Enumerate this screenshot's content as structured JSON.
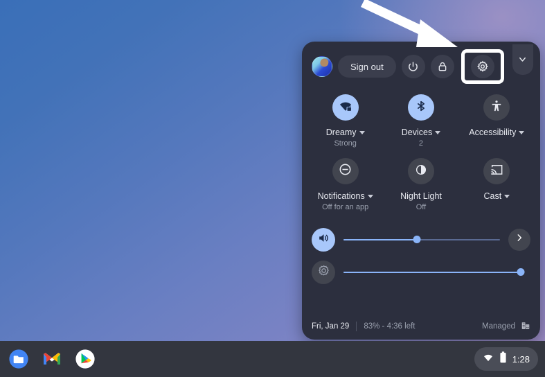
{
  "wallpaper": {
    "gradient_start": "#3a6fb8",
    "gradient_end": "#a08ac0"
  },
  "annotation": {
    "arrow_color": "#ffffff",
    "points_to": "settings-gear-button",
    "highlight_color": "#ffffff"
  },
  "quick_settings": {
    "panel_bg": "#2c2f3e",
    "top_row": {
      "avatar_name": "user-avatar",
      "sign_out_label": "Sign out",
      "power_label": "power-icon",
      "lock_label": "lock-icon",
      "settings_label": "gear-icon",
      "collapse_label": "chevron-down-icon"
    },
    "tiles": [
      {
        "id": "network",
        "icon": "wifi-locked-icon",
        "label": "Dreamy",
        "sublabel": "Strong",
        "state": "on",
        "has_caret": true
      },
      {
        "id": "bluetooth",
        "icon": "bluetooth-icon",
        "label": "Devices",
        "sublabel": "2",
        "state": "on",
        "has_caret": true
      },
      {
        "id": "accessibility",
        "icon": "accessibility-icon",
        "label": "Accessibility",
        "sublabel": "",
        "state": "off",
        "has_caret": true
      },
      {
        "id": "notifications",
        "icon": "do-not-disturb-icon",
        "label": "Notifications",
        "sublabel": "Off for an app",
        "state": "off",
        "has_caret": true
      },
      {
        "id": "night-light",
        "icon": "night-light-icon",
        "label": "Night Light",
        "sublabel": "Off",
        "state": "off",
        "has_caret": false
      },
      {
        "id": "cast",
        "icon": "cast-icon",
        "label": "Cast",
        "sublabel": "",
        "state": "off",
        "has_caret": true
      }
    ],
    "sliders": [
      {
        "id": "volume",
        "icon": "volume-up-icon",
        "value": 47,
        "state": "on",
        "has_expand": true,
        "expand_icon": "chevron-right-icon"
      },
      {
        "id": "brightness",
        "icon": "brightness-icon",
        "value": 100,
        "state": "off",
        "has_expand": false
      }
    ],
    "footer": {
      "date": "Fri, Jan 29",
      "battery": "83% - 4:36 left",
      "managed_label": "Managed",
      "managed_icon": "enterprise-building-icon"
    },
    "accent_color": "#8ab4f8",
    "tile_on_color": "#a8c7fa"
  },
  "shelf": {
    "bg": "#33363f",
    "apps": [
      {
        "id": "files",
        "name": "Files"
      },
      {
        "id": "gmail",
        "name": "Gmail"
      },
      {
        "id": "play-store",
        "name": "Play Store"
      }
    ],
    "status": {
      "wifi_icon": "wifi-icon",
      "battery_icon": "battery-icon",
      "time": "1:28"
    }
  }
}
